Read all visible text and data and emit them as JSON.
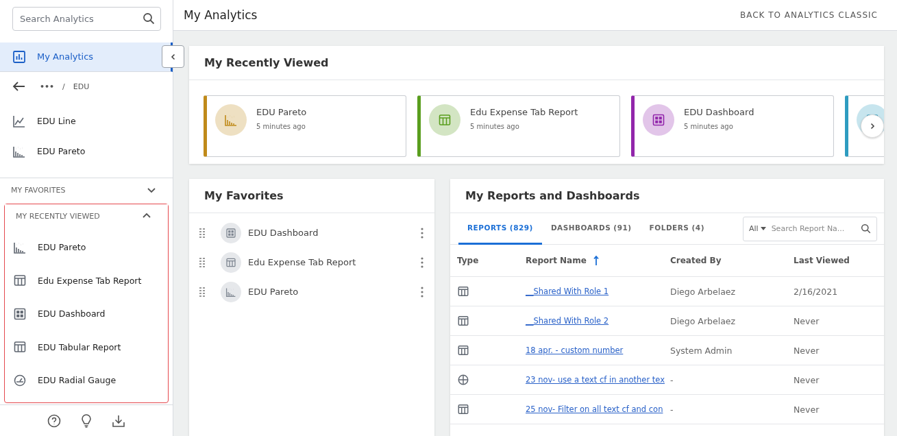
{
  "sidebar": {
    "search": {
      "placeholder": "Search Analytics"
    },
    "nav": {
      "label": "My Analytics",
      "selected": true
    },
    "breadcrumb": {
      "ellipsis": "•••",
      "separator": "/",
      "current": "EDU"
    },
    "items": [
      {
        "label": "EDU Line",
        "kind": "line"
      },
      {
        "label": "EDU Pareto",
        "kind": "pareto"
      }
    ],
    "sections": [
      {
        "title": "MY FAVORITES",
        "expanded": false
      },
      {
        "title": "MY RECENTLY VIEWED",
        "expanded": true,
        "items": [
          {
            "label": "EDU Pareto",
            "kind": "pareto"
          },
          {
            "label": "Edu Expense Tab Report",
            "kind": "table"
          },
          {
            "label": "EDU Dashboard",
            "kind": "dashboard"
          },
          {
            "label": "EDU Tabular Report",
            "kind": "table"
          },
          {
            "label": "EDU Radial Gauge",
            "kind": "gauge"
          }
        ]
      }
    ]
  },
  "header": {
    "title": "My Analytics",
    "link": "BACK TO ANALYTICS CLASSIC"
  },
  "recently_viewed": {
    "title": "My Recently Viewed",
    "cards": [
      {
        "title": "EDU Pareto",
        "time": "5 minutes ago",
        "kind": "pareto",
        "color": "#c08a1a"
      },
      {
        "title": "Edu Expense Tab Report",
        "time": "5 minutes ago",
        "kind": "table",
        "color": "#5a9e1e"
      },
      {
        "title": "EDU Dashboard",
        "time": "5 minutes ago",
        "kind": "dashboard",
        "color": "#9226ab"
      },
      {
        "kind": "table",
        "color": "#2e9cc0"
      }
    ]
  },
  "favorites": {
    "title": "My Favorites",
    "items": [
      {
        "label": "EDU Dashboard",
        "kind": "dashboard"
      },
      {
        "label": "Edu Expense Tab Report",
        "kind": "table"
      },
      {
        "label": "EDU Pareto",
        "kind": "pareto"
      }
    ]
  },
  "reports": {
    "title": "My Reports and Dashboards",
    "tabs": [
      {
        "label": "REPORTS (829)",
        "selected": true
      },
      {
        "label": "DASHBOARDS (91)",
        "selected": false
      },
      {
        "label": "FOLDERS (4)",
        "selected": false
      }
    ],
    "filter": "All",
    "search": {
      "placeholder": "Search Report Na..."
    },
    "columns": [
      "Type",
      "Report Name",
      "Created By",
      "Last Viewed"
    ],
    "rows": [
      {
        "kind": "table",
        "name": "__Shared With Role 1",
        "created_by": "Diego Arbelaez",
        "last_viewed": "2/16/2021"
      },
      {
        "kind": "table",
        "name": "__Shared With Role 2",
        "created_by": "Diego Arbelaez",
        "last_viewed": "Never"
      },
      {
        "kind": "table",
        "name": "18 apr. - custom number",
        "created_by": "System Admin",
        "last_viewed": "Never"
      },
      {
        "kind": "globe",
        "name": "23 nov- use a text cf in another tex",
        "created_by": "-",
        "last_viewed": "Never"
      },
      {
        "kind": "table",
        "name": "25 nov- Filter on all text cf and con",
        "created_by": "-",
        "last_viewed": "Never"
      }
    ]
  }
}
